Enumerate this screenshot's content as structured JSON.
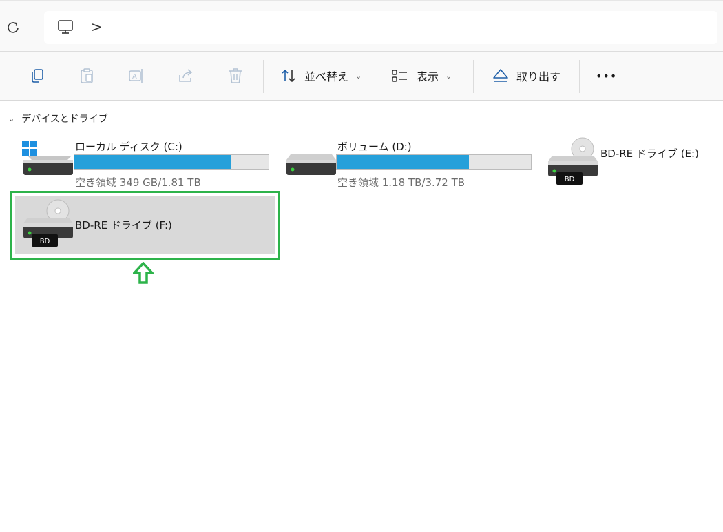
{
  "address_bar": {
    "refresh_icon": "refresh-icon",
    "location_icon": "this-pc-icon",
    "breadcrumb_separator": ">"
  },
  "toolbar": {
    "icons": [
      "copy-icon",
      "paste-icon",
      "rename-icon",
      "share-icon",
      "delete-icon"
    ],
    "sort_label": "並べ替え",
    "view_label": "表示",
    "eject_label": "取り出す",
    "more_label": "•••"
  },
  "section": {
    "title": "デバイスとドライブ"
  },
  "drives": [
    {
      "name": "ローカル ディスク (C:)",
      "used_fraction": 0.81,
      "space_text": "空き領域 349 GB/1.81 TB",
      "icon": "windows-drive-icon"
    },
    {
      "name": "ボリューム (D:)",
      "used_fraction": 0.68,
      "space_text": "空き領域 1.18 TB/3.72 TB",
      "icon": "hard-drive-icon"
    },
    {
      "name": "BD-RE ドライブ (E:)",
      "icon": "bd-drive-icon",
      "badge": "BD"
    },
    {
      "name": "BD-RE ドライブ (F:)",
      "icon": "bd-drive-icon",
      "badge": "BD",
      "selected": true
    }
  ],
  "colors": {
    "accent_bar": "#26a0da",
    "highlight": "#2db34a",
    "selected_bg": "#d9d9d9"
  }
}
